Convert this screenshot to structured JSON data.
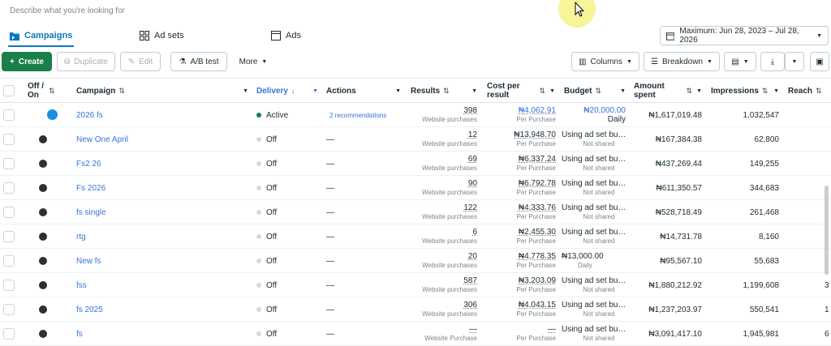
{
  "search": {
    "placeholder": "Describe what you're looking for"
  },
  "tabs": [
    {
      "label": "Campaigns",
      "icon": "folder-icon"
    },
    {
      "label": "Ad sets",
      "icon": "grid-icon"
    },
    {
      "label": "Ads",
      "icon": "ad-icon"
    }
  ],
  "date_range": {
    "label": "Maximum: Jun 28, 2023 – Jul 28, 2026"
  },
  "toolbar": {
    "create": "Create",
    "duplicate": "Duplicate",
    "edit": "Edit",
    "ab_test": "A/B test",
    "more": "More",
    "columns": "Columns",
    "breakdown": "Breakdown"
  },
  "columns": {
    "offon": "Off / On",
    "campaign": "Campaign",
    "delivery": "Delivery",
    "actions": "Actions",
    "results": "Results",
    "cost": "Cost per result",
    "budget": "Budget",
    "amount": "Amount spent",
    "impressions": "Impressions",
    "reach": "Reach"
  },
  "rows": [
    {
      "on": true,
      "name": "2026 fs",
      "delivery": "Active",
      "actions": "2 recommendations",
      "results": "398",
      "results_sub": "Website purchases",
      "cost": "₦4,062.91",
      "cost_sub": "Per Purchase",
      "budget": "₦20,000.00",
      "budget_sub": "Daily",
      "amount": "₦1,617,019.48",
      "impressions": "1,032,547",
      "reach": ""
    },
    {
      "on": false,
      "name": "New One April",
      "delivery": "Off",
      "actions": "—",
      "results": "12",
      "results_sub": "Website purchases",
      "cost": "₦13,948.70",
      "cost_sub": "Per Purchase",
      "budget": "Using ad set bu…",
      "budget_sub": "Not shared",
      "amount": "₦167,384.38",
      "impressions": "62,800",
      "reach": ""
    },
    {
      "on": false,
      "name": "Fs2 26",
      "delivery": "Off",
      "actions": "—",
      "results": "69",
      "results_sub": "Website purchases",
      "cost": "₦6,337.24",
      "cost_sub": "Per Purchase",
      "budget": "Using ad set bu…",
      "budget_sub": "Not shared",
      "amount": "₦437,269.44",
      "impressions": "149,255",
      "reach": ""
    },
    {
      "on": false,
      "name": "Fs 2026",
      "delivery": "Off",
      "actions": "—",
      "results": "90",
      "results_sub": "Website purchases",
      "cost": "₦6,792.78",
      "cost_sub": "Per Purchase",
      "budget": "Using ad set bu…",
      "budget_sub": "Not shared",
      "amount": "₦611,350.57",
      "impressions": "344,683",
      "reach": ""
    },
    {
      "on": false,
      "name": "fs single",
      "delivery": "Off",
      "actions": "—",
      "results": "122",
      "results_sub": "Website purchases",
      "cost": "₦4,333.76",
      "cost_sub": "Per Purchase",
      "budget": "Using ad set bu…",
      "budget_sub": "Not shared",
      "amount": "₦528,718.49",
      "impressions": "261,468",
      "reach": ""
    },
    {
      "on": false,
      "name": "rtg",
      "delivery": "Off",
      "actions": "—",
      "results": "6",
      "results_sub": "Website purchases",
      "cost": "₦2,455.30",
      "cost_sub": "Per Purchase",
      "budget": "Using ad set bu…",
      "budget_sub": "Not shared",
      "amount": "₦14,731.78",
      "impressions": "8,160",
      "reach": ""
    },
    {
      "on": false,
      "name": "New fs",
      "delivery": "Off",
      "actions": "—",
      "results": "20",
      "results_sub": "Website purchases",
      "cost": "₦4,778.35",
      "cost_sub": "Per Purchase",
      "budget": "₦13,000.00",
      "budget_sub": "Daily",
      "amount": "₦95,567.10",
      "impressions": "55,683",
      "reach": ""
    },
    {
      "on": false,
      "name": "fss",
      "delivery": "Off",
      "actions": "—",
      "results": "587",
      "results_sub": "Website purchases",
      "cost": "₦3,203.09",
      "cost_sub": "Per Purchase",
      "budget": "Using ad set bu…",
      "budget_sub": "Not shared",
      "amount": "₦1,880,212.92",
      "impressions": "1,199,608",
      "reach": "3"
    },
    {
      "on": false,
      "name": "fs 2025",
      "delivery": "Off",
      "actions": "—",
      "results": "306",
      "results_sub": "Website purchases",
      "cost": "₦4,043.15",
      "cost_sub": "Per Purchase",
      "budget": "Using ad set bu…",
      "budget_sub": "Not shared",
      "amount": "₦1,237,203.97",
      "impressions": "550,541",
      "reach": "1"
    },
    {
      "on": false,
      "name": "fs",
      "delivery": "Off",
      "actions": "—",
      "results": "—",
      "results_sub": "Website Purchase",
      "cost": "—",
      "cost_sub": "Per Purchase",
      "budget": "Using ad set bu…",
      "budget_sub": "Not shared",
      "amount": "₦3,091,417.10",
      "impressions": "1,945,981",
      "reach": "6"
    }
  ]
}
